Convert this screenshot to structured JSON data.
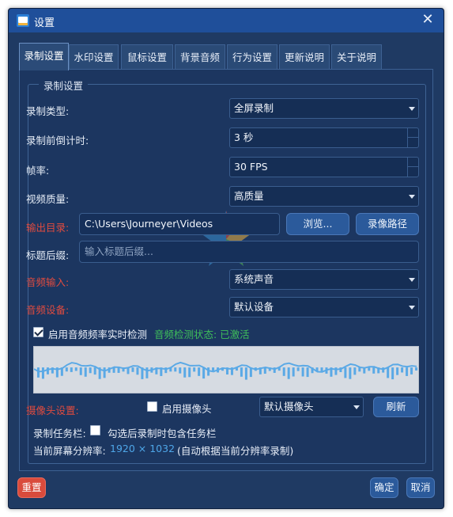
{
  "window": {
    "title": "设置"
  },
  "tabs": [
    {
      "label": "录制设置"
    },
    {
      "label": "水印设置"
    },
    {
      "label": "鼠标设置"
    },
    {
      "label": "背景音频"
    },
    {
      "label": "行为设置"
    },
    {
      "label": "更新说明"
    },
    {
      "label": "关于说明"
    }
  ],
  "group": {
    "title": "录制设置"
  },
  "record_type": {
    "label": "录制类型:",
    "value": "全屏录制"
  },
  "countdown": {
    "label": "录制前倒计时:",
    "value": "3 秒"
  },
  "frame_rate": {
    "label": "帧率:",
    "value": "30 FPS"
  },
  "video_quality": {
    "label": "视频质量:",
    "value": "高质量"
  },
  "output_dir": {
    "label": "输出目录:",
    "value": "C:\\Users\\Journeyer\\Videos",
    "browse_label": "浏览...",
    "path_label": "录像路径"
  },
  "title_suffix": {
    "label": "标题后缀:",
    "placeholder": "输入标题后缀..."
  },
  "audio_input": {
    "label": "音频输入:",
    "value": "系统声音"
  },
  "audio_device": {
    "label": "音频设备:",
    "value": "默认设备"
  },
  "audio_monitor": {
    "checkbox_label": "启用音频频率实时检测",
    "checked": true,
    "status_text": "音频检测状态: 已激活"
  },
  "camera": {
    "label": "摄像头设置:",
    "checkbox_label": "启用摄像头",
    "checked": false,
    "select_value": "默认摄像头",
    "refresh_label": "刷新"
  },
  "taskbar": {
    "label": "录制任务栏:",
    "checkbox_label": "勾选后录制时包含任务栏",
    "checked": false
  },
  "resolution": {
    "label": "当前屏幕分辨率:",
    "value": "1920 × 1032",
    "note": "(自动根据当前分辨率录制)"
  },
  "footer": {
    "reset_label": "重置",
    "ok_label": "确定",
    "cancel_label": "取消"
  },
  "colors": {
    "accent": "#2b5a9b",
    "warning_label": "#e04b3f",
    "status_ok": "#3fbf5a",
    "wave": "#5aa9e6"
  }
}
